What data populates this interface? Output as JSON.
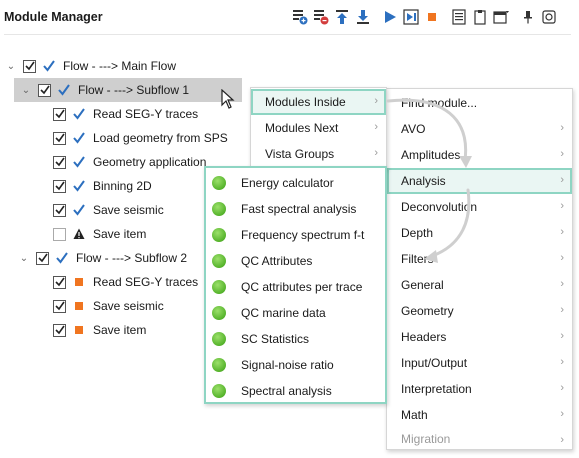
{
  "panel": {
    "title": "Module Manager"
  },
  "toolbar": {
    "icons": [
      "add-module-icon",
      "remove-module-icon",
      "move-up-icon",
      "move-down-icon",
      "run-icon",
      "run-step-icon",
      "stop-icon",
      "list-icon",
      "clipboard-icon",
      "window-icon",
      "pin-icon",
      "close-icon"
    ],
    "stop_color": "#f07520",
    "arrow_color": "#2c6fbf"
  },
  "tree": {
    "rows": [
      {
        "label": "Flow - ---> Main Flow",
        "checked": true,
        "status": "check"
      },
      {
        "label": "Flow - ---> Subflow 1",
        "checked": true,
        "status": "check"
      },
      {
        "label": "Read SEG-Y traces",
        "checked": true,
        "status": "check"
      },
      {
        "label": "Load geometry from SPS",
        "checked": true,
        "status": "check"
      },
      {
        "label": "Geometry application",
        "checked": true,
        "status": "check"
      },
      {
        "label": "Binning 2D",
        "checked": true,
        "status": "check"
      },
      {
        "label": "Save seismic",
        "checked": true,
        "status": "check"
      },
      {
        "label": "Save item",
        "checked": false,
        "status": "warning"
      },
      {
        "label": "Flow - ---> Subflow 2",
        "checked": true,
        "status": "check"
      },
      {
        "label": "Read SEG-Y traces",
        "checked": true,
        "status": "orange"
      },
      {
        "label": "Save seismic",
        "checked": true,
        "status": "orange"
      },
      {
        "label": "Save item",
        "checked": true,
        "status": "orange"
      }
    ]
  },
  "context_menu": {
    "items": [
      {
        "label": "Modules Inside",
        "arrow": "›"
      },
      {
        "label": "Modules Next",
        "arrow": "›"
      },
      {
        "label": "Vista Groups",
        "arrow": "›"
      }
    ]
  },
  "analysis_menu": {
    "items": [
      {
        "label": "Energy calculator"
      },
      {
        "label": "Fast spectral analysis"
      },
      {
        "label": "Frequency spectrum f-t"
      },
      {
        "label": "QC Attributes"
      },
      {
        "label": "QC attributes per trace"
      },
      {
        "label": "QC marine data"
      },
      {
        "label": "SC Statistics"
      },
      {
        "label": "Signal-noise ratio"
      },
      {
        "label": "Spectral analysis"
      }
    ]
  },
  "category_menu": {
    "items": [
      {
        "label": "Find module...",
        "arrow": ""
      },
      {
        "label": "AVO",
        "arrow": "›"
      },
      {
        "label": "Amplitudes",
        "arrow": "›"
      },
      {
        "label": "Analysis",
        "arrow": "›"
      },
      {
        "label": "Deconvolution",
        "arrow": "›"
      },
      {
        "label": "Depth",
        "arrow": "›"
      },
      {
        "label": "Filters",
        "arrow": "›"
      },
      {
        "label": "General",
        "arrow": "›"
      },
      {
        "label": "Geometry",
        "arrow": "›"
      },
      {
        "label": "Headers",
        "arrow": "›"
      },
      {
        "label": "Input/Output",
        "arrow": "›"
      },
      {
        "label": "Interpretation",
        "arrow": "›"
      },
      {
        "label": "Math",
        "arrow": "›"
      },
      {
        "label": "Migration",
        "arrow": "›"
      }
    ]
  },
  "highlight_color": "#8ed5c3"
}
